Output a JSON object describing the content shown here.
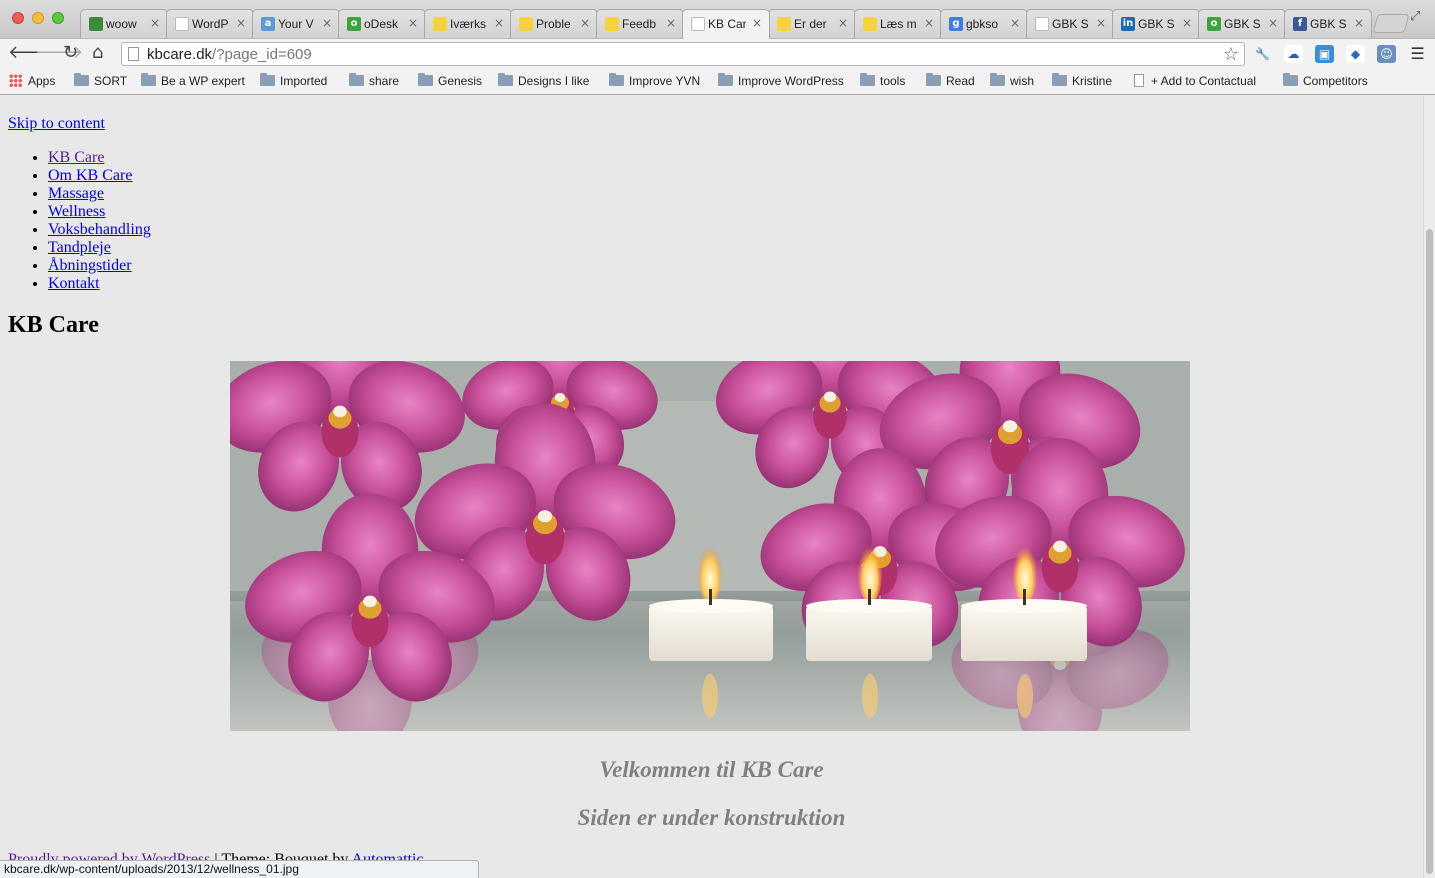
{
  "browser": {
    "tabs": [
      {
        "title": "woow",
        "favicon_color": "#3c8b3c",
        "favicon_glyph": "",
        "icon": "leaf-icon"
      },
      {
        "title": "WordP",
        "favicon_color": "#ffffff",
        "favicon_glyph": "",
        "icon": "blank-page-icon"
      },
      {
        "title": "Your V",
        "favicon_color": "#5b9bd5",
        "favicon_glyph": "a",
        "icon": "a-icon"
      },
      {
        "title": "oDesk",
        "favicon_color": "#3aa53a",
        "favicon_glyph": "o",
        "icon": "odesk-icon"
      },
      {
        "title": "Iværks",
        "favicon_color": "#f7d23c",
        "favicon_glyph": "",
        "icon": "bulb-icon"
      },
      {
        "title": "Proble",
        "favicon_color": "#f7d23c",
        "favicon_glyph": "",
        "icon": "bulb-icon"
      },
      {
        "title": "Feedb",
        "favicon_color": "#f7d23c",
        "favicon_glyph": "",
        "icon": "bulb-icon"
      },
      {
        "title": "KB Car",
        "favicon_color": "#ffffff",
        "favicon_glyph": "",
        "icon": "blank-page-icon"
      },
      {
        "title": "Er der",
        "favicon_color": "#f7d23c",
        "favicon_glyph": "",
        "icon": "bulb-icon"
      },
      {
        "title": "Læs m",
        "favicon_color": "#f7d23c",
        "favicon_glyph": "",
        "icon": "bulb-icon"
      },
      {
        "title": "gbkso",
        "favicon_color": "#3f7de0",
        "favicon_glyph": "g",
        "icon": "google-icon"
      },
      {
        "title": "GBK S",
        "favicon_color": "#ffffff",
        "favicon_glyph": "",
        "icon": "loading-icon"
      },
      {
        "title": "GBK S",
        "favicon_color": "#1a6bb0",
        "favicon_glyph": "in",
        "icon": "linkedin-icon"
      },
      {
        "title": "GBK S",
        "favicon_color": "#3aa53a",
        "favicon_glyph": "o",
        "icon": "odesk-icon"
      },
      {
        "title": "GBK S",
        "favicon_color": "#3b5998",
        "favicon_glyph": "f",
        "icon": "facebook-icon"
      }
    ],
    "active_tab_index": 7,
    "url_host": "kbcare.dk",
    "url_path": "/?page_id=609",
    "bookmarks": [
      {
        "label": "Apps",
        "kind": "apps"
      },
      {
        "label": "SORT",
        "kind": "folder"
      },
      {
        "label": "Be a WP expert",
        "kind": "folder"
      },
      {
        "label": "Imported",
        "kind": "folder"
      },
      {
        "label": "share",
        "kind": "folder"
      },
      {
        "label": "Genesis",
        "kind": "folder"
      },
      {
        "label": "Designs I like",
        "kind": "folder"
      },
      {
        "label": "Improve YVN",
        "kind": "folder"
      },
      {
        "label": "Improve WordPress",
        "kind": "folder"
      },
      {
        "label": "tools",
        "kind": "folder"
      },
      {
        "label": "Read",
        "kind": "folder"
      },
      {
        "label": "wish",
        "kind": "folder"
      },
      {
        "label": "Kristine",
        "kind": "folder"
      },
      {
        "label": "+ Add to Contactual",
        "kind": "page"
      },
      {
        "label": "Competitors",
        "kind": "folder"
      }
    ],
    "status_url": "kbcare.dk/wp-content/uploads/2013/12/wellness_01.jpg"
  },
  "page": {
    "skip_link": "Skip to content",
    "menu": [
      "KB Care",
      "Om KB Care",
      "Massage",
      "Wellness",
      "Voksbehandling",
      "Tandpleje",
      "Åbningstider",
      "Kontakt"
    ],
    "site_title": "KB Care",
    "welcome": "Velkommen til KB Care",
    "construction": "Siden er under konstruktion",
    "footer": {
      "powered": "Proudly powered by WordPress",
      "separator": " | Theme: Bouquet by ",
      "author": "Automattic."
    }
  },
  "colors": {
    "link": "#0000ee",
    "visited": "#551a8b",
    "orchid": "#c8509a",
    "welcome_text": "#808080"
  }
}
